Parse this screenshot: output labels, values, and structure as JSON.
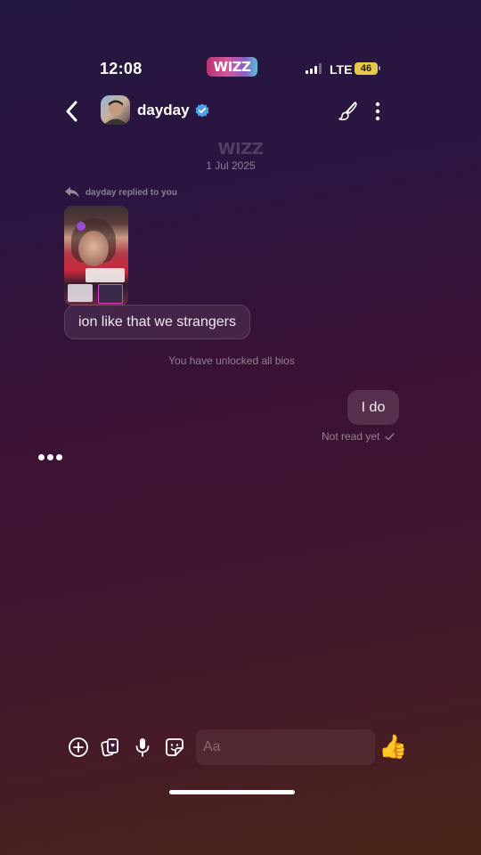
{
  "status_bar": {
    "time": "12:08",
    "app_logo_text": "WIZZ",
    "network": "LTE",
    "battery": "46"
  },
  "header": {
    "username": "dayday",
    "verified_icon": "verified-badge-icon",
    "back_icon": "chevron-left-icon",
    "brush_icon": "paintbrush-icon",
    "more_icon": "more-vertical-icon"
  },
  "conversation": {
    "date_logo": "WIZZ",
    "date": "1 Jul 2025",
    "reply_note": "dayday replied to you",
    "incoming_message": "ion like that we strangers",
    "system_note": "You have unlocked all bios",
    "outgoing_message": "I do",
    "read_status": "Not read yet"
  },
  "composer": {
    "placeholder": "Aa",
    "thumbs_up": "👍",
    "tools": [
      "plus-circle-icon",
      "cards-icon",
      "microphone-icon",
      "sticker-icon"
    ]
  },
  "colors": {
    "background_top": "#231640",
    "background_mid": "#3f1432",
    "background_bottom": "#4a2418",
    "verified_blue": "#4aa3e8",
    "battery_yellow": "#e6c84a"
  }
}
